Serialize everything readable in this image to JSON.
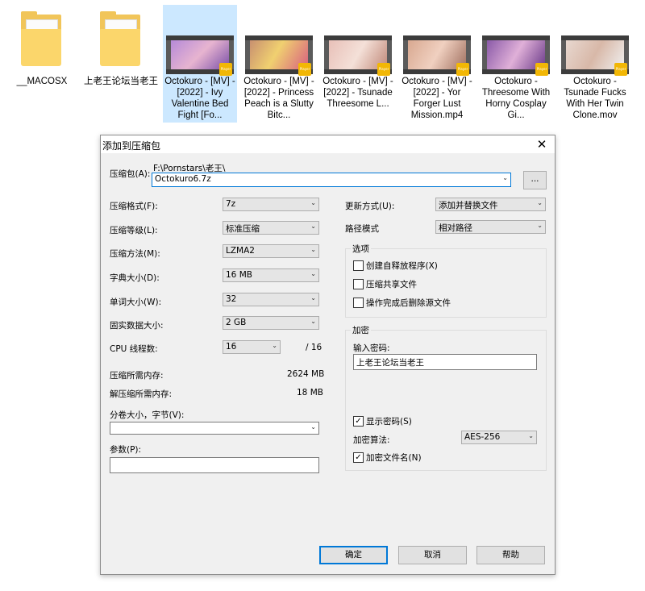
{
  "files": [
    {
      "name": "__MACOSX",
      "type": "folder"
    },
    {
      "name": "上老王论坛当老王",
      "type": "folder"
    },
    {
      "name": "Octokuro - [MV] - [2022] - Ivy Valentine Bed Fight [Fo...",
      "type": "video",
      "selected": true
    },
    {
      "name": "Octokuro - [MV] - [2022] - Princess Peach is a Slutty Bitc...",
      "type": "video"
    },
    {
      "name": "Octokuro - [MV] - [2022] - Tsunade Threesome L...",
      "type": "video"
    },
    {
      "name": "Octokuro - [MV] - [2022] - Yor Forger Lust Mission.mp4",
      "type": "video"
    },
    {
      "name": "Octokuro - Threesome With Horny Cosplay Gi...",
      "type": "video"
    },
    {
      "name": "Octokuro - Tsunade Fucks With Her Twin Clone.mov",
      "type": "video"
    }
  ],
  "badge_text": "Player",
  "dialog": {
    "title": "添加到压缩包",
    "close": "✕",
    "archive_label": "压缩包(A):",
    "archive_path": "F:\\Pornstars\\老王\\",
    "archive_name": "Octokuro6.7z",
    "browse": "...",
    "format_label": "压缩格式(F):",
    "format_value": "7z",
    "level_label": "压缩等级(L):",
    "level_value": "标准压缩",
    "method_label": "压缩方法(M):",
    "method_value": "LZMA2",
    "dict_label": "字典大小(D):",
    "dict_value": "16 MB",
    "word_label": "单词大小(W):",
    "word_value": "32",
    "solid_label": "固实数据大小:",
    "solid_value": "2 GB",
    "cpu_label": "CPU 线程数:",
    "cpu_value": "16",
    "cpu_total": "/ 16",
    "mem_comp_label": "压缩所需内存:",
    "mem_comp_value": "2624 MB",
    "mem_decomp_label": "解压缩所需内存:",
    "mem_decomp_value": "18 MB",
    "split_label": "分卷大小，字节(V):",
    "params_label": "参数(P):",
    "update_label": "更新方式(U):",
    "update_value": "添加并替换文件",
    "pathmode_label": "路径模式",
    "pathmode_value": "相对路径",
    "options_title": "选项",
    "opt_sfx": "创建自释放程序(X)",
    "opt_shared": "压缩共享文件",
    "opt_delete": "操作完成后删除源文件",
    "enc_title": "加密",
    "pwd_label": "输入密码:",
    "pwd_value": "上老王论坛当老王",
    "show_pwd": "显示密码(S)",
    "enc_method_label": "加密算法:",
    "enc_method_value": "AES-256",
    "enc_names": "加密文件名(N)",
    "ok": "确定",
    "cancel": "取消",
    "help": "帮助",
    "checked_mark": "✓"
  }
}
